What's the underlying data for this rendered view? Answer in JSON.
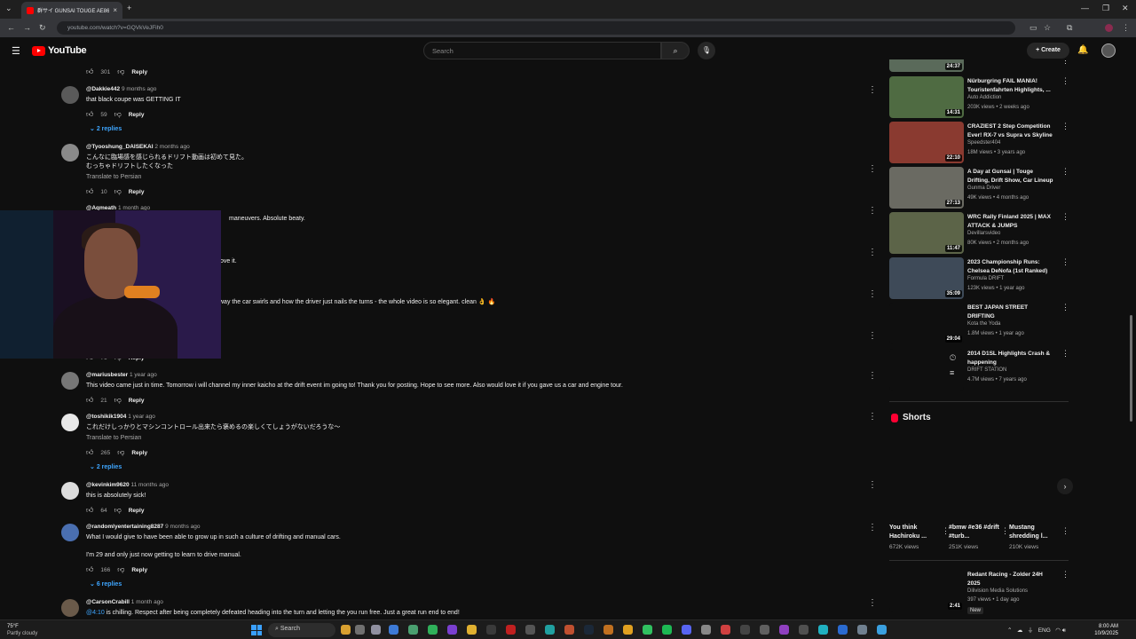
{
  "browser": {
    "tab_title": "群サイ GUNSAI TOUGE AE86 D...",
    "url": "youtube.com/watch?v=GQVkVeJFih0"
  },
  "header": {
    "logo": "YouTube",
    "search_placeholder": "Search",
    "create_label": "Create"
  },
  "comments": [
    {
      "id": "c0",
      "likes": "301",
      "reply_label": "Reply"
    },
    {
      "id": "c1",
      "author": "@Dakkie442",
      "time": "9 months ago",
      "text": "that black coupe was GETTING IT",
      "likes": "59",
      "reply_label": "Reply",
      "replies": "2 replies"
    },
    {
      "id": "c2",
      "author": "@Tyooshung_DAISEKAI",
      "time": "2 months ago",
      "text": "こんなに臨場感を感じられるドリフト動画は初めて見た。",
      "text2": "むっちゃドリフトしたくなった",
      "translate": "Translate to Persian",
      "likes": "10",
      "reply_label": "Reply"
    },
    {
      "id": "c3",
      "author": "@Aqmeath",
      "time": "1 month ago",
      "text": "maneuvers. Absolute beaty."
    },
    {
      "id": "c4",
      "text": "ove it."
    },
    {
      "id": "c5",
      "text": "way the car swirls and how the driver just nails the  turns - the whole video is so elegant. clean 👌 🔥"
    },
    {
      "id": "c6",
      "likes": "76",
      "reply_label": "Reply"
    },
    {
      "id": "c7",
      "author": "@mariusbester",
      "time": "1 year ago",
      "text": "This video came just in time. Tomorrow i will channel my inner kaicho at the drift event im going to! Thank you for posting. Hope to see more. Also would love it if you gave us a car and engine tour.",
      "likes": "21",
      "reply_label": "Reply"
    },
    {
      "id": "c8",
      "author": "@toshikik1904",
      "time": "1 year ago",
      "text": "これだけしっかりとマシンコントロール出来たら褒めるの楽しくてしょうがないだろうな～",
      "translate": "Translate to Persian",
      "likes": "265",
      "reply_label": "Reply",
      "replies": "2 replies"
    },
    {
      "id": "c9",
      "author": "@kevinkim9620",
      "time": "11 months ago",
      "text": "this is absolutely sick!",
      "likes": "64",
      "reply_label": "Reply"
    },
    {
      "id": "c10",
      "author": "@randomlyentertaining8287",
      "time": "9 months ago",
      "text": "What I would give to have been able to grow up in such a culture of drifting and manual cars.",
      "text2": "I'm 29 and only just now getting to learn to drive manual.",
      "likes": "166",
      "reply_label": "Reply",
      "replies": "6 replies"
    },
    {
      "id": "c11",
      "author": "@CarsonCrabill",
      "time": "1 month ago",
      "ts": "@4:10",
      "text": " is chilling. Respect after being completely defeated heading into the turn and letting the you run free. Just a great run end to end!"
    }
  ],
  "sidebar": {
    "videos": [
      {
        "title": "",
        "channel": "",
        "views": "",
        "duration": "24:37"
      },
      {
        "title": "Nürburgring FAIL MANIA! Touristenfahrten Highlights, ...",
        "channel": "Auto Addiction",
        "views": "203K views • 2 weeks ago",
        "duration": "14:31"
      },
      {
        "title": "CRAZIEST 2 Step Competition Ever! RX-7 vs Supra vs Skyline ...",
        "channel": "Speedster404",
        "views": "18M views • 3 years ago",
        "duration": "22:10"
      },
      {
        "title": "A Day at Gunsai | Touge Drifting, Drift Show, Car Lineup 4K",
        "channel": "Gunma Driver",
        "views": "49K views • 4 months ago",
        "duration": "27:13"
      },
      {
        "title": "WRC Rally Finland 2025 | MAX ATTACK & JUMPS",
        "channel": "Devillarsvideo",
        "views": "80K views • 2 months ago",
        "duration": "11:47"
      },
      {
        "title": "2023 Championship Runs: Chelsea DeNofa (1st Ranked)",
        "channel": "Formula DRIFT",
        "views": "123K views • 1 year ago",
        "duration": "35:09"
      },
      {
        "title": "BEST JAPAN STREET DRIFTING",
        "channel": "Kota the Yoda",
        "views": "1.8M views • 1 year ago",
        "duration": "29:04"
      },
      {
        "title": "2014 D1SL Highlights Crash & happening",
        "channel": "DRIFT STATION",
        "views": "4.7M views • 7 years ago",
        "duration": ""
      }
    ],
    "shorts_heading": "Shorts",
    "shorts": [
      {
        "title": "You think Hachiroku ...",
        "views": "672K views"
      },
      {
        "title": "#bmw #e36 #drift #turb...",
        "views": "251K views"
      },
      {
        "title": "Mustang shredding l...",
        "views": "210K views"
      }
    ],
    "bottom_video": {
      "title": "Redant Racing - Zolder 24H 2025",
      "channel": "Dilivision Media Solutions",
      "views": "397 views • 1 day ago",
      "badge": "New",
      "duration": "2:41"
    }
  },
  "taskbar": {
    "temp": "75°F",
    "weather": "Partly cloudy",
    "search": "Search",
    "lang": "ENG",
    "time": "8:00 AM",
    "date": "10/9/2025"
  },
  "colors": {
    "accent_red": "#ff0000",
    "link_blue": "#3ea6ff",
    "background": "#0f0f0f"
  }
}
